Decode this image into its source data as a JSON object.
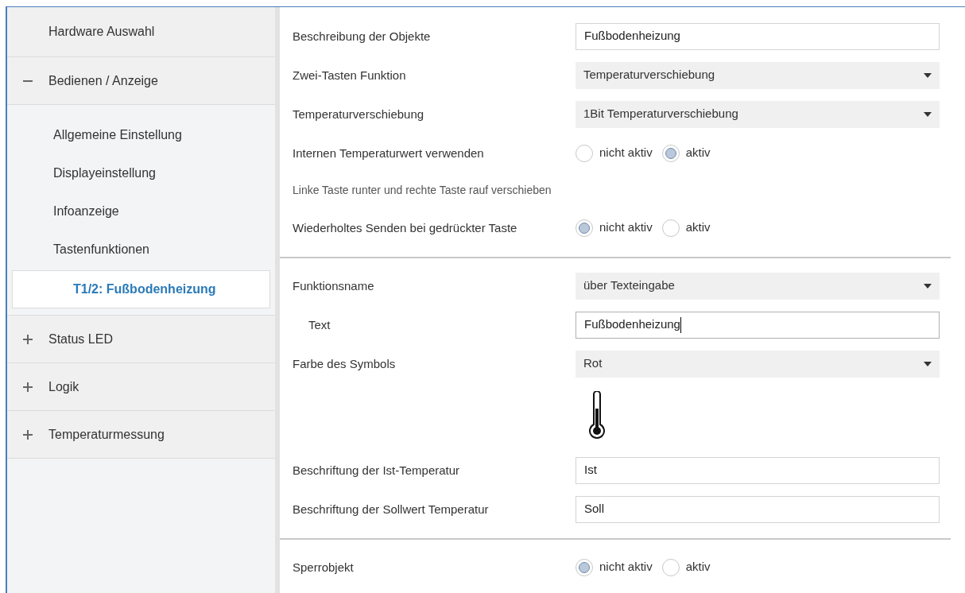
{
  "sidebar": {
    "items": [
      {
        "label": "Hardware Auswahl",
        "kind": "plain",
        "selected": false
      },
      {
        "label": "Bedienen / Anzeige",
        "kind": "group",
        "expanded": true,
        "selected": false,
        "children": [
          {
            "label": "Allgemeine Einstellung",
            "selected": false
          },
          {
            "label": "Displayeinstellung",
            "selected": false
          },
          {
            "label": "Infoanzeige",
            "selected": false
          },
          {
            "label": "Tastenfunktionen",
            "selected": false,
            "children": [
              {
                "label": "T1/2: Fußbodenheizung",
                "selected": true
              }
            ]
          }
        ]
      },
      {
        "label": "Status LED",
        "kind": "group",
        "expanded": false,
        "selected": false
      },
      {
        "label": "Logik",
        "kind": "group",
        "expanded": false,
        "selected": false
      },
      {
        "label": "Temperaturmessung",
        "kind": "group",
        "expanded": false,
        "selected": false
      }
    ]
  },
  "parameters": [
    {
      "kind": "text",
      "label": "Beschreibung der Objekte",
      "value": "Fußbodenheizung",
      "focused": false
    },
    {
      "kind": "dropdown",
      "label": "Zwei-Tasten Funktion",
      "value": "Temperaturverschiebung"
    },
    {
      "kind": "dropdown",
      "label": "Temperaturverschiebung",
      "value": "1Bit Temperaturverschiebung"
    },
    {
      "kind": "radio",
      "label": "Internen Temperaturwert verwenden",
      "options": [
        {
          "label": "nicht aktiv",
          "selected": false
        },
        {
          "label": "aktiv",
          "selected": true
        }
      ]
    },
    {
      "kind": "note",
      "label": "Linke Taste runter und rechte Taste rauf verschieben"
    },
    {
      "kind": "radio",
      "label": "Wiederholtes Senden bei gedrückter Taste",
      "options": [
        {
          "label": "nicht aktiv",
          "selected": true
        },
        {
          "label": "aktiv",
          "selected": false
        }
      ]
    },
    {
      "kind": "divider"
    },
    {
      "kind": "dropdown",
      "label": "Funktionsname",
      "value": "über Texteingabe",
      "children": [
        {
          "kind": "text",
          "label": "Text",
          "value": "Fußbodenheizung",
          "focused": true
        }
      ]
    },
    {
      "kind": "dropdown",
      "label": "Farbe des Symbols",
      "value": "Rot"
    },
    {
      "kind": "symbol"
    },
    {
      "kind": "text",
      "label": "Beschriftung der Ist-Temperatur",
      "value": "Ist",
      "focused": false
    },
    {
      "kind": "text",
      "label": "Beschriftung der Sollwert Temperatur",
      "value": "Soll",
      "focused": false
    },
    {
      "kind": "divider"
    },
    {
      "kind": "radio",
      "label": "Sperrobjekt",
      "options": [
        {
          "label": "nicht aktiv",
          "selected": true
        },
        {
          "label": "aktiv",
          "selected": false
        }
      ]
    }
  ]
}
